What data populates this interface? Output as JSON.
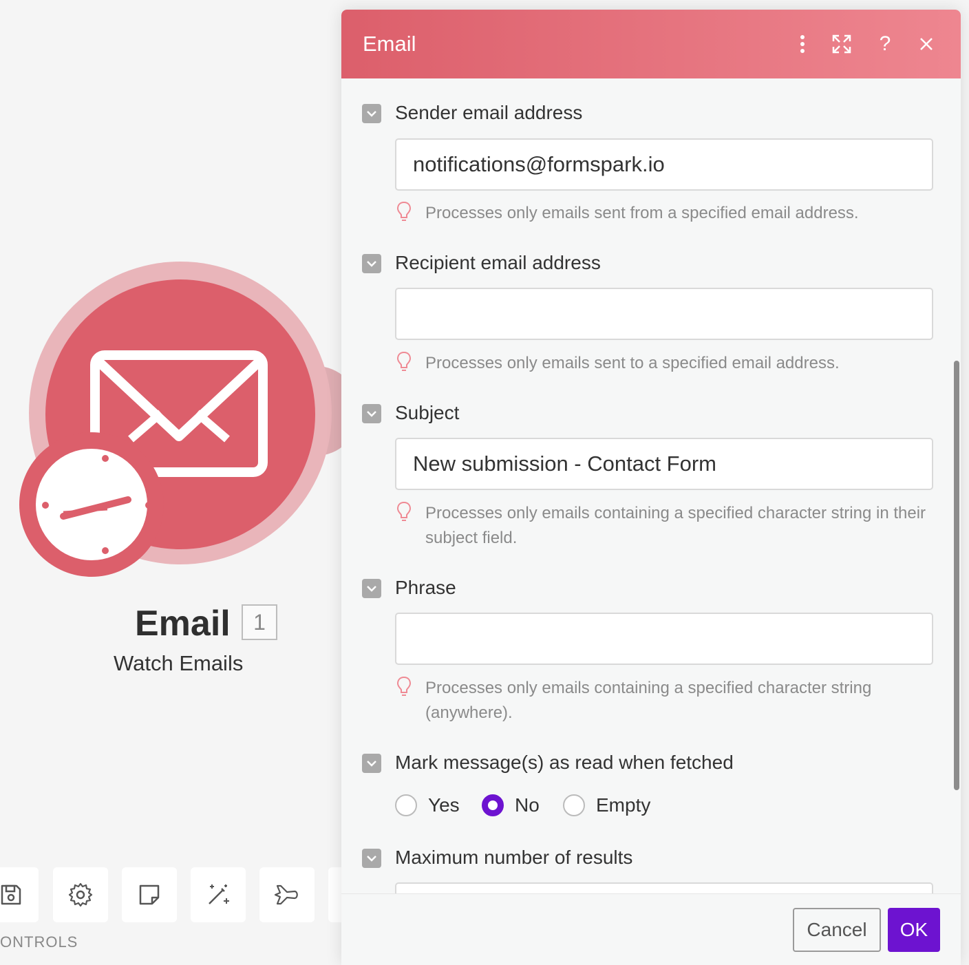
{
  "canvas": {
    "module": {
      "title": "Email",
      "badge": "1",
      "subtitle": "Watch Emails",
      "icon": "envelope-icon",
      "trigger_icon": "clock-icon",
      "color": "#dc5f6b"
    },
    "toolbar": {
      "items": [
        {
          "name": "save",
          "icon": "floppy-disk-icon"
        },
        {
          "name": "settings",
          "icon": "gear-icon"
        },
        {
          "name": "notes",
          "icon": "note-icon"
        },
        {
          "name": "auto-align",
          "icon": "magic-wand-icon"
        },
        {
          "name": "explain-flow",
          "icon": "airplane-icon"
        }
      ],
      "controls_label": "ONTROLS"
    }
  },
  "dialog": {
    "title": "Email",
    "header_icons": [
      "more-vertical-icon",
      "expand-icon",
      "help-icon",
      "close-icon"
    ],
    "accent_color": "#dc5f6b",
    "primary_color": "#6d13d0",
    "fields": {
      "sender": {
        "label": "Sender email address",
        "value": "notifications@formspark.io",
        "hint": "Processes only emails sent from a specified email address."
      },
      "recipient": {
        "label": "Recipient email address",
        "value": "",
        "hint": "Processes only emails sent to a specified email address."
      },
      "subject": {
        "label": "Subject",
        "value": "New submission - Contact Form",
        "hint": "Processes only emails containing a specified character string in their subject field."
      },
      "phrase": {
        "label": "Phrase",
        "value": "",
        "hint": "Processes only emails containing a specified character string (anywhere)."
      },
      "mark_read": {
        "label": "Mark message(s) as read when fetched",
        "options": [
          "Yes",
          "No",
          "Empty"
        ],
        "selected": "No"
      },
      "max_results": {
        "label": "Maximum number of results"
      }
    },
    "footer": {
      "cancel_label": "Cancel",
      "ok_label": "OK"
    }
  }
}
